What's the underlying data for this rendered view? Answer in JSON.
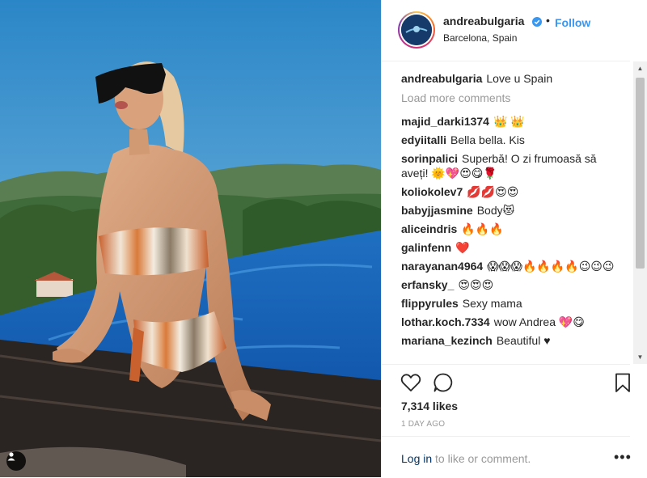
{
  "post": {
    "username": "andreabulgaria",
    "follow_label": "Follow",
    "dot": "•",
    "location": "Barcelona, Spain",
    "caption": "Love u Spain",
    "load_more": "Load more comments",
    "comments": [
      {
        "user": "majid_darki1374",
        "text": "👑 👑"
      },
      {
        "user": "edyiitalli",
        "text": "Bella bella. Kis"
      },
      {
        "user": "sorinpalici",
        "text": "Superbă! O zi frumoasă să aveți! 🌞💖😍😋🌹"
      },
      {
        "user": "koliokolev7",
        "text": "💋💋😍😍"
      },
      {
        "user": "babyjjasmine",
        "text": "Body😻"
      },
      {
        "user": "aliceindris",
        "text": "🔥🔥🔥"
      },
      {
        "user": "galinfenn",
        "text": "❤️"
      },
      {
        "user": "narayanan4964",
        "text": "😱😱😱🔥🔥🔥🔥😉😉😉"
      },
      {
        "user": "erfansky_",
        "text": "😍😍😍"
      },
      {
        "user": "flippyrules",
        "text": "Sexy mama"
      },
      {
        "user": "lothar.koch.7334",
        "text": "wow Andrea 💖😋"
      },
      {
        "user": "mariana_kezinch",
        "text": "Beautiful ♥"
      }
    ],
    "likes": "7,314 likes",
    "time": "1 DAY AGO",
    "login_link": "Log in",
    "login_rest": " to like or comment.",
    "more": "•••"
  },
  "colors": {
    "accent": "#3897f0",
    "verified": "#3897f0",
    "muted": "#999999",
    "text": "#262626"
  },
  "icons": [
    "verified-badge-icon",
    "heart-icon",
    "comment-icon",
    "bookmark-icon",
    "more-icon",
    "user-tag-icon"
  ]
}
